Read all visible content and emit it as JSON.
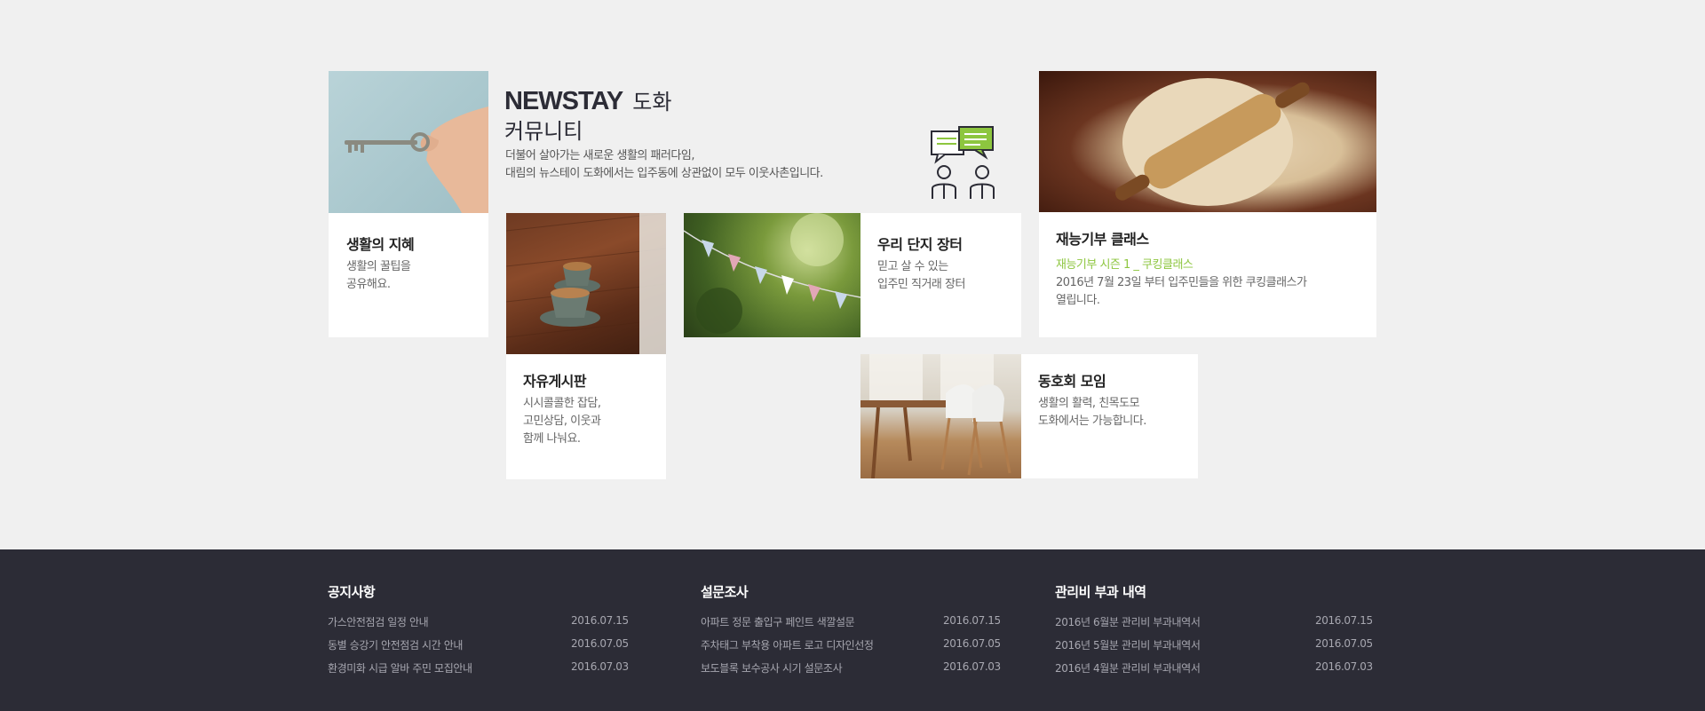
{
  "community": {
    "brand": "NEWSTAY",
    "place": "도화",
    "subtitle": "커뮤니티",
    "desc_line1": "더불어 살아가는 새로운 생활의 패러다임,",
    "desc_line2": "대림의 뉴스테이 도화에서는 입주동에 상관없이 모두 이웃사촌입니다."
  },
  "cards": {
    "tips": {
      "title": "생활의 지혜",
      "line1": "생활의 꿀팁을",
      "line2": "공유해요."
    },
    "board": {
      "title": "자유게시판",
      "line1": "시시콜콜한 잡담,",
      "line2": "고민상담, 이웃과",
      "line3": "함께 나눠요."
    },
    "market": {
      "title": "우리 단지 장터",
      "line1": "믿고 살 수 있는",
      "line2": "입주민 직거래 장터"
    },
    "talent": {
      "title": "재능기부 클래스",
      "highlight": "재능기부 시즌 1 _ 쿠킹클래스",
      "line1": "2016년 7월 23일 부터 입주민들을 위한 쿠킹클래스가",
      "line2": "열립니다."
    },
    "club": {
      "title": "동호회 모임",
      "line1": "생활의 활력, 친목도모",
      "line2": "도화에서는 가능합니다."
    }
  },
  "footer": {
    "notice": {
      "title": "공지사항",
      "items": [
        {
          "text": "가스안전점검 일정 안내",
          "date": "2016.07.15"
        },
        {
          "text": "동별 승강기 안전점검 시간 안내",
          "date": "2016.07.05"
        },
        {
          "text": "환경미화 시급 알바 주민 모집안내",
          "date": "2016.07.03"
        }
      ]
    },
    "survey": {
      "title": "설문조사",
      "items": [
        {
          "text": "아파트 정문 출입구 페인트 색깔설문",
          "date": "2016.07.15"
        },
        {
          "text": "주차태그 부착용 아파트 로고 디자인선정",
          "date": "2016.07.05"
        },
        {
          "text": "보도블록 보수공사 시기 설문조사",
          "date": "2016.07.03"
        }
      ]
    },
    "fees": {
      "title": "관리비 부과 내역",
      "items": [
        {
          "text": "2016년 6월분 관리비 부과내역서",
          "date": "2016.07.15"
        },
        {
          "text": "2016년 5월분 관리비 부과내역서",
          "date": "2016.07.05"
        },
        {
          "text": "2016년 4월분 관리비 부과내역서",
          "date": "2016.07.03"
        }
      ]
    }
  },
  "colors": {
    "accent": "#8dc63f",
    "footer_bg": "#2c2c36",
    "page_bg": "#f0f0f0"
  }
}
